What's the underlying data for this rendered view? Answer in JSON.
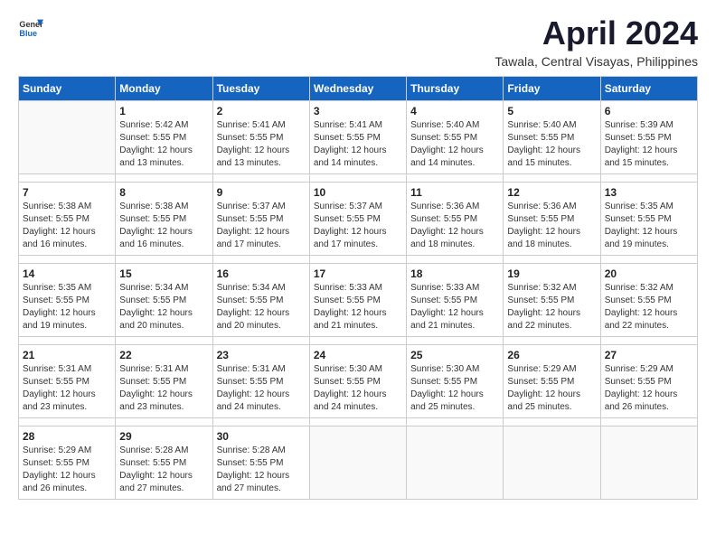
{
  "header": {
    "logo_general": "General",
    "logo_blue": "Blue",
    "month_title": "April 2024",
    "subtitle": "Tawala, Central Visayas, Philippines"
  },
  "weekdays": [
    "Sunday",
    "Monday",
    "Tuesday",
    "Wednesday",
    "Thursday",
    "Friday",
    "Saturday"
  ],
  "weeks": [
    [
      {
        "day": "",
        "info": ""
      },
      {
        "day": "1",
        "info": "Sunrise: 5:42 AM\nSunset: 5:55 PM\nDaylight: 12 hours\nand 13 minutes."
      },
      {
        "day": "2",
        "info": "Sunrise: 5:41 AM\nSunset: 5:55 PM\nDaylight: 12 hours\nand 13 minutes."
      },
      {
        "day": "3",
        "info": "Sunrise: 5:41 AM\nSunset: 5:55 PM\nDaylight: 12 hours\nand 14 minutes."
      },
      {
        "day": "4",
        "info": "Sunrise: 5:40 AM\nSunset: 5:55 PM\nDaylight: 12 hours\nand 14 minutes."
      },
      {
        "day": "5",
        "info": "Sunrise: 5:40 AM\nSunset: 5:55 PM\nDaylight: 12 hours\nand 15 minutes."
      },
      {
        "day": "6",
        "info": "Sunrise: 5:39 AM\nSunset: 5:55 PM\nDaylight: 12 hours\nand 15 minutes."
      }
    ],
    [
      {
        "day": "7",
        "info": "Sunrise: 5:38 AM\nSunset: 5:55 PM\nDaylight: 12 hours\nand 16 minutes."
      },
      {
        "day": "8",
        "info": "Sunrise: 5:38 AM\nSunset: 5:55 PM\nDaylight: 12 hours\nand 16 minutes."
      },
      {
        "day": "9",
        "info": "Sunrise: 5:37 AM\nSunset: 5:55 PM\nDaylight: 12 hours\nand 17 minutes."
      },
      {
        "day": "10",
        "info": "Sunrise: 5:37 AM\nSunset: 5:55 PM\nDaylight: 12 hours\nand 17 minutes."
      },
      {
        "day": "11",
        "info": "Sunrise: 5:36 AM\nSunset: 5:55 PM\nDaylight: 12 hours\nand 18 minutes."
      },
      {
        "day": "12",
        "info": "Sunrise: 5:36 AM\nSunset: 5:55 PM\nDaylight: 12 hours\nand 18 minutes."
      },
      {
        "day": "13",
        "info": "Sunrise: 5:35 AM\nSunset: 5:55 PM\nDaylight: 12 hours\nand 19 minutes."
      }
    ],
    [
      {
        "day": "14",
        "info": "Sunrise: 5:35 AM\nSunset: 5:55 PM\nDaylight: 12 hours\nand 19 minutes."
      },
      {
        "day": "15",
        "info": "Sunrise: 5:34 AM\nSunset: 5:55 PM\nDaylight: 12 hours\nand 20 minutes."
      },
      {
        "day": "16",
        "info": "Sunrise: 5:34 AM\nSunset: 5:55 PM\nDaylight: 12 hours\nand 20 minutes."
      },
      {
        "day": "17",
        "info": "Sunrise: 5:33 AM\nSunset: 5:55 PM\nDaylight: 12 hours\nand 21 minutes."
      },
      {
        "day": "18",
        "info": "Sunrise: 5:33 AM\nSunset: 5:55 PM\nDaylight: 12 hours\nand 21 minutes."
      },
      {
        "day": "19",
        "info": "Sunrise: 5:32 AM\nSunset: 5:55 PM\nDaylight: 12 hours\nand 22 minutes."
      },
      {
        "day": "20",
        "info": "Sunrise: 5:32 AM\nSunset: 5:55 PM\nDaylight: 12 hours\nand 22 minutes."
      }
    ],
    [
      {
        "day": "21",
        "info": "Sunrise: 5:31 AM\nSunset: 5:55 PM\nDaylight: 12 hours\nand 23 minutes."
      },
      {
        "day": "22",
        "info": "Sunrise: 5:31 AM\nSunset: 5:55 PM\nDaylight: 12 hours\nand 23 minutes."
      },
      {
        "day": "23",
        "info": "Sunrise: 5:31 AM\nSunset: 5:55 PM\nDaylight: 12 hours\nand 24 minutes."
      },
      {
        "day": "24",
        "info": "Sunrise: 5:30 AM\nSunset: 5:55 PM\nDaylight: 12 hours\nand 24 minutes."
      },
      {
        "day": "25",
        "info": "Sunrise: 5:30 AM\nSunset: 5:55 PM\nDaylight: 12 hours\nand 25 minutes."
      },
      {
        "day": "26",
        "info": "Sunrise: 5:29 AM\nSunset: 5:55 PM\nDaylight: 12 hours\nand 25 minutes."
      },
      {
        "day": "27",
        "info": "Sunrise: 5:29 AM\nSunset: 5:55 PM\nDaylight: 12 hours\nand 26 minutes."
      }
    ],
    [
      {
        "day": "28",
        "info": "Sunrise: 5:29 AM\nSunset: 5:55 PM\nDaylight: 12 hours\nand 26 minutes."
      },
      {
        "day": "29",
        "info": "Sunrise: 5:28 AM\nSunset: 5:55 PM\nDaylight: 12 hours\nand 27 minutes."
      },
      {
        "day": "30",
        "info": "Sunrise: 5:28 AM\nSunset: 5:55 PM\nDaylight: 12 hours\nand 27 minutes."
      },
      {
        "day": "",
        "info": ""
      },
      {
        "day": "",
        "info": ""
      },
      {
        "day": "",
        "info": ""
      },
      {
        "day": "",
        "info": ""
      }
    ]
  ]
}
